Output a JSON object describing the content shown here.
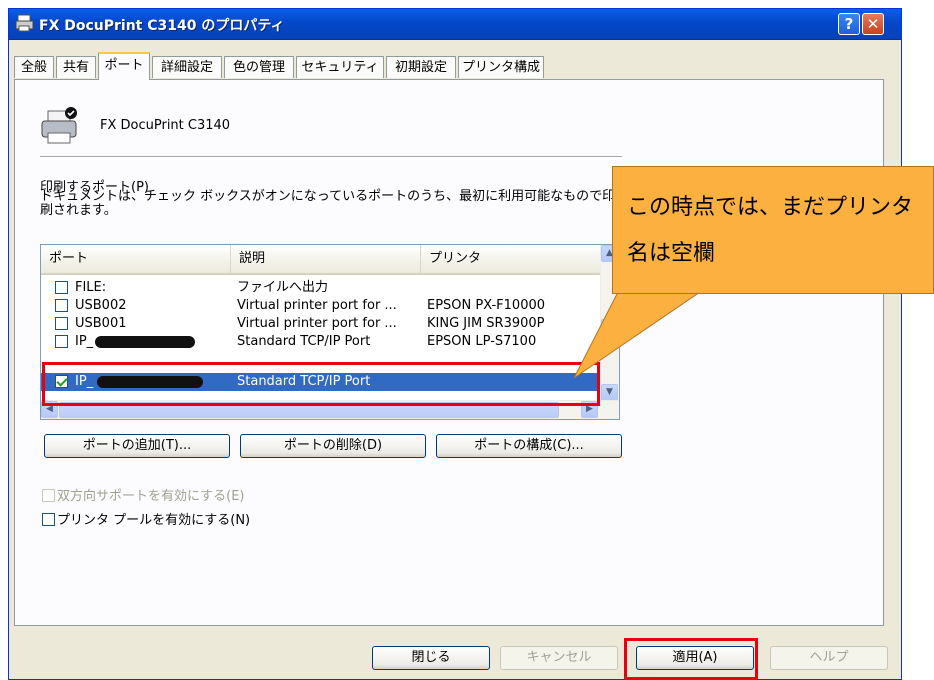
{
  "window": {
    "title": "FX DocuPrint C3140 のプロパティ",
    "help_label": "?",
    "close_label": "✕"
  },
  "tabs": [
    {
      "label": "全般"
    },
    {
      "label": "共有"
    },
    {
      "label": "ポート",
      "active": true
    },
    {
      "label": "詳細設定"
    },
    {
      "label": "色の管理"
    },
    {
      "label": "セキュリティ"
    },
    {
      "label": "初期設定"
    },
    {
      "label": "プリンタ構成"
    }
  ],
  "printer": {
    "name": "FX DocuPrint C3140"
  },
  "ports_section": {
    "label": "印刷するポート(P)",
    "description": "ドキュメントは、チェック ボックスがオンになっているポートのうち、最初に利用可能なもので印刷されます。"
  },
  "port_list": {
    "columns": [
      "ポート",
      "説明",
      "プリンタ"
    ],
    "rows": [
      {
        "port": "FILE:",
        "description": "ファイルへ出力",
        "printer": "",
        "checked": false
      },
      {
        "port": "USB002",
        "description": "Virtual printer port for ...",
        "printer": "EPSON PX-F10000",
        "checked": false
      },
      {
        "port": "USB001",
        "description": "Virtual printer port for ...",
        "printer": "KING JIM SR3900P",
        "checked": false
      },
      {
        "port": "IP_",
        "description": "Standard TCP/IP Port",
        "printer": "EPSON LP-S7100",
        "checked": false
      },
      {
        "port": "IP_",
        "description": "Standard TCP/IP Port",
        "printer": "",
        "checked": true,
        "selected": true
      }
    ]
  },
  "buttons": {
    "add_port": "ポートの追加(T)...",
    "delete_port": "ポートの削除(D)",
    "configure_port": "ポートの構成(C)...",
    "close": "閉じる",
    "cancel": "キャンセル",
    "apply": "適用(A)",
    "help": "ヘルプ"
  },
  "checkboxes": {
    "bidirectional": "双方向サポートを有効にする(E)",
    "printer_pool": "プリンタ プールを有効にする(N)"
  },
  "callout": {
    "text": "この時点では、まだプリンタ名は空欄"
  },
  "colors": {
    "highlight": "#e8000e",
    "callout": "#fbb040",
    "selection": "#316ac5"
  }
}
